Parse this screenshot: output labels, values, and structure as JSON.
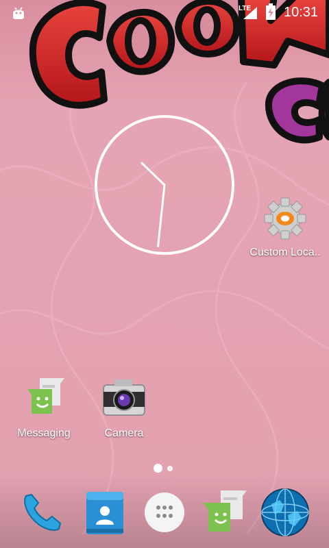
{
  "status_bar": {
    "network": "LTE",
    "time": "10:31",
    "icons": [
      "android-notification-icon",
      "signal-icon",
      "battery-charging-icon"
    ]
  },
  "wallpaper": {
    "theme": "cookie-comic",
    "background_color": "#e3a2b1"
  },
  "clock_widget": {
    "hour_angle_deg": 314,
    "minute_angle_deg": 186
  },
  "desktop_apps": [
    {
      "label": "Custom Loca..",
      "icon": "settings-gear-icon"
    },
    {
      "label": "Messaging",
      "icon": "messaging-icon"
    },
    {
      "label": "Camera",
      "icon": "camera-icon"
    }
  ],
  "pager": {
    "pages": 2,
    "current": 1
  },
  "dock": [
    {
      "name": "phone",
      "icon": "phone-icon"
    },
    {
      "name": "contacts",
      "icon": "contacts-icon"
    },
    {
      "name": "app-drawer",
      "icon": "app-drawer-icon"
    },
    {
      "name": "messaging",
      "icon": "messaging-icon"
    },
    {
      "name": "browser",
      "icon": "globe-icon"
    }
  ]
}
